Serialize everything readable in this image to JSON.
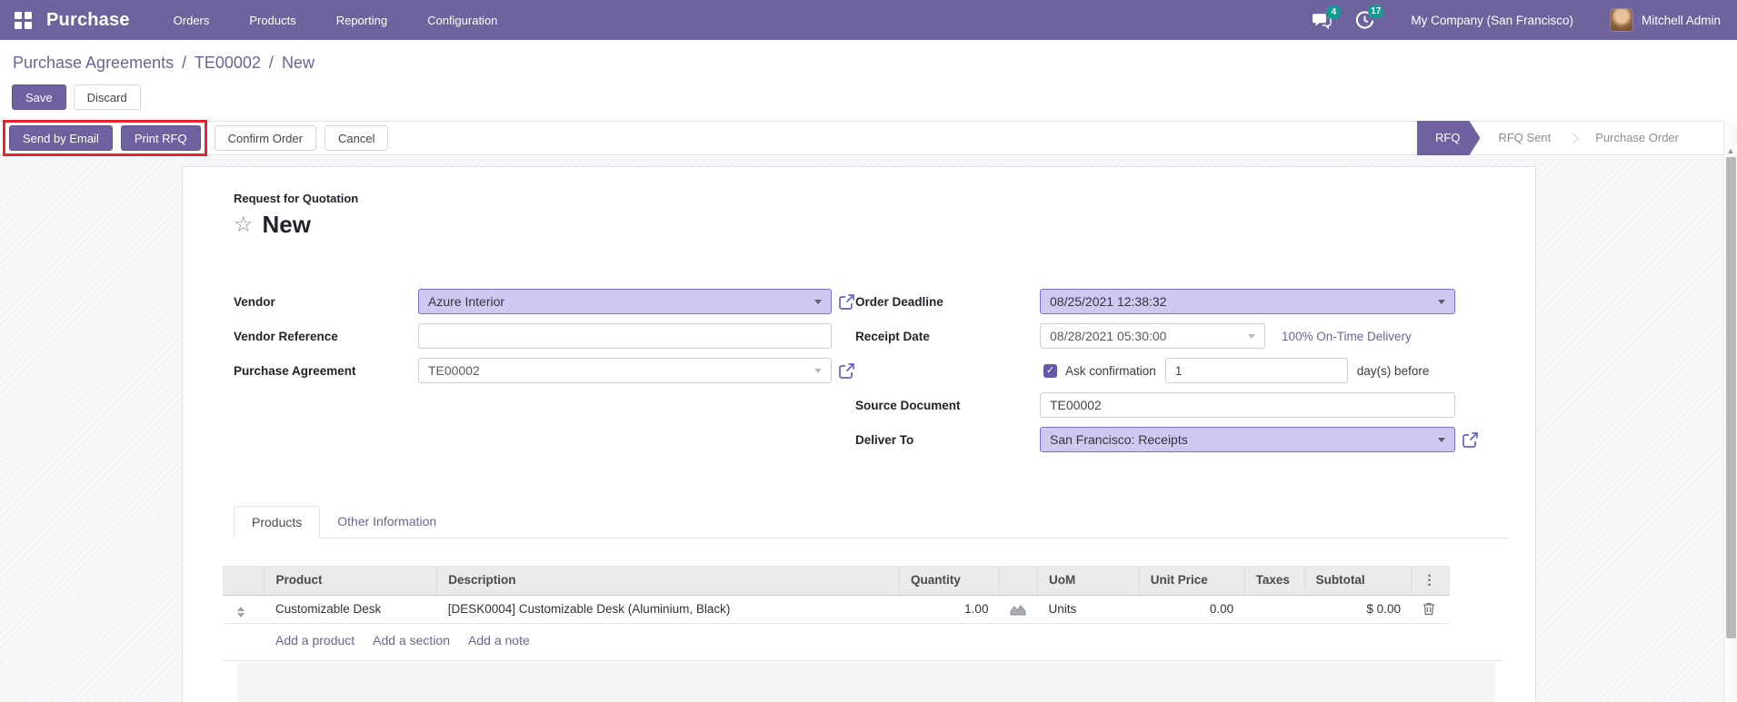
{
  "nav": {
    "app_name": "Purchase",
    "menus": [
      "Orders",
      "Products",
      "Reporting",
      "Configuration"
    ],
    "messages_badge": "4",
    "activities_badge": "17",
    "company": "My Company (San Francisco)",
    "user": "Mitchell Admin"
  },
  "breadcrumb": {
    "items": [
      "Purchase Agreements",
      "TE00002",
      "New"
    ],
    "separator": "/"
  },
  "buttons": {
    "save": "Save",
    "discard": "Discard",
    "send_by_email": "Send by Email",
    "print_rfq": "Print RFQ",
    "confirm_order": "Confirm Order",
    "cancel": "Cancel"
  },
  "statusbar": {
    "stages": [
      {
        "label": "RFQ",
        "active": true
      },
      {
        "label": "RFQ Sent",
        "active": false
      },
      {
        "label": "Purchase Order",
        "active": false
      }
    ]
  },
  "form": {
    "subtitle": "Request for Quotation",
    "title": "New",
    "fields": {
      "vendor": {
        "label": "Vendor",
        "value": "Azure Interior"
      },
      "vendor_reference": {
        "label": "Vendor Reference",
        "value": ""
      },
      "purchase_agreement": {
        "label": "Purchase Agreement",
        "value": "TE00002"
      },
      "order_deadline": {
        "label": "Order Deadline",
        "value": "08/25/2021 12:38:32"
      },
      "receipt_date": {
        "label": "Receipt Date",
        "value": "08/28/2021 05:30:00",
        "note": "100% On-Time Delivery"
      },
      "ask_confirmation": {
        "label": "Ask confirmation",
        "checked": true,
        "value": "1",
        "suffix": "day(s) before"
      },
      "source_document": {
        "label": "Source Document",
        "value": "TE00002"
      },
      "deliver_to": {
        "label": "Deliver To",
        "value": "San Francisco: Receipts"
      }
    }
  },
  "tabs": [
    {
      "label": "Products",
      "active": true
    },
    {
      "label": "Other Information",
      "active": false
    }
  ],
  "products_table": {
    "headers": {
      "product": "Product",
      "description": "Description",
      "quantity": "Quantity",
      "uom": "UoM",
      "unit_price": "Unit Price",
      "taxes": "Taxes",
      "subtotal": "Subtotal"
    },
    "rows": [
      {
        "product": "Customizable Desk",
        "description": "[DESK0004] Customizable Desk (Aluminium, Black)",
        "quantity": "1.00",
        "uom": "Units",
        "unit_price": "0.00",
        "taxes": "",
        "subtotal": "$ 0.00"
      }
    ],
    "links": [
      "Add a product",
      "Add a section",
      "Add a note"
    ]
  },
  "icons": {
    "star": "☆",
    "kebab": "⋮",
    "check": "✓",
    "scroll_up": "▲"
  },
  "colors": {
    "nav_background": "#6e639d",
    "primary_button": "#6f609f",
    "field_highlight": "#cdc9f0",
    "badge_teal": "#0f9d92",
    "highlight_red": "#e8232b",
    "link_purple": "#6d6393"
  }
}
